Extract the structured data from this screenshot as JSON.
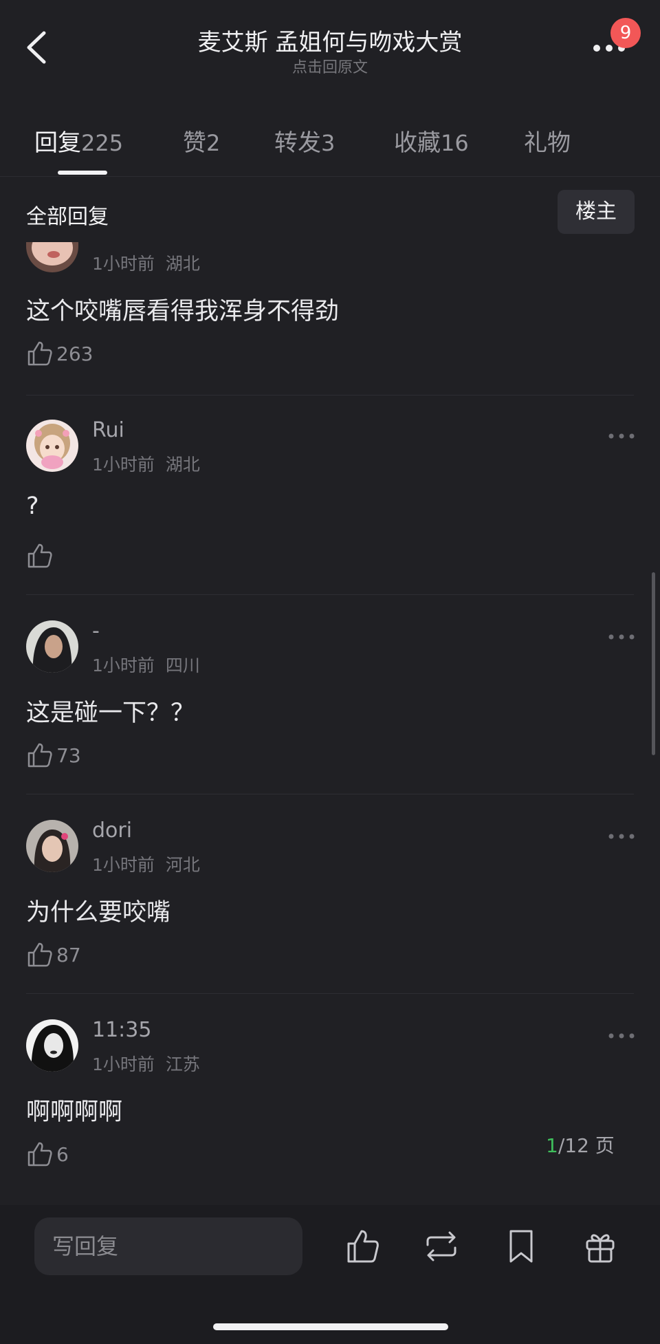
{
  "header": {
    "title": "麦艾斯 孟姐何与吻戏大赏",
    "subtitle": "点击回原文",
    "notification_count": "9"
  },
  "tabs": [
    {
      "label": "回复",
      "count": "225",
      "active": true
    },
    {
      "label": "赞",
      "count": "2",
      "active": false
    },
    {
      "label": "转发",
      "count": "3",
      "active": false
    },
    {
      "label": "收藏",
      "count": "16",
      "active": false
    },
    {
      "label": "礼物",
      "count": "",
      "active": false
    }
  ],
  "section": {
    "title": "全部回复",
    "owner_filter_label": "楼主"
  },
  "comments": [
    {
      "username": "",
      "time": "1小时前",
      "location": "湖北",
      "text": "这个咬嘴唇看得我浑身不得劲",
      "likes": "263"
    },
    {
      "username": "Rui",
      "time": "1小时前",
      "location": "湖北",
      "text": "?",
      "likes": ""
    },
    {
      "username": "-",
      "time": "1小时前",
      "location": "四川",
      "text": "这是碰一下？？",
      "likes": "73"
    },
    {
      "username": "dori",
      "time": "1小时前",
      "location": "河北",
      "text": "为什么要咬嘴",
      "likes": "87"
    },
    {
      "username": "11:35",
      "time": "1小时前",
      "location": "江苏",
      "text": "啊啊啊啊",
      "likes": "6"
    }
  ],
  "pager": {
    "current": "1",
    "rest": "/12 页"
  },
  "bottom_bar": {
    "reply_placeholder": "写回复",
    "icons": [
      "thumbs-up-icon",
      "repost-icon",
      "bookmark-icon",
      "gift-icon"
    ]
  },
  "colors": {
    "background": "#202024",
    "accent_green": "#3fbf5c",
    "badge_red": "#f25757"
  }
}
